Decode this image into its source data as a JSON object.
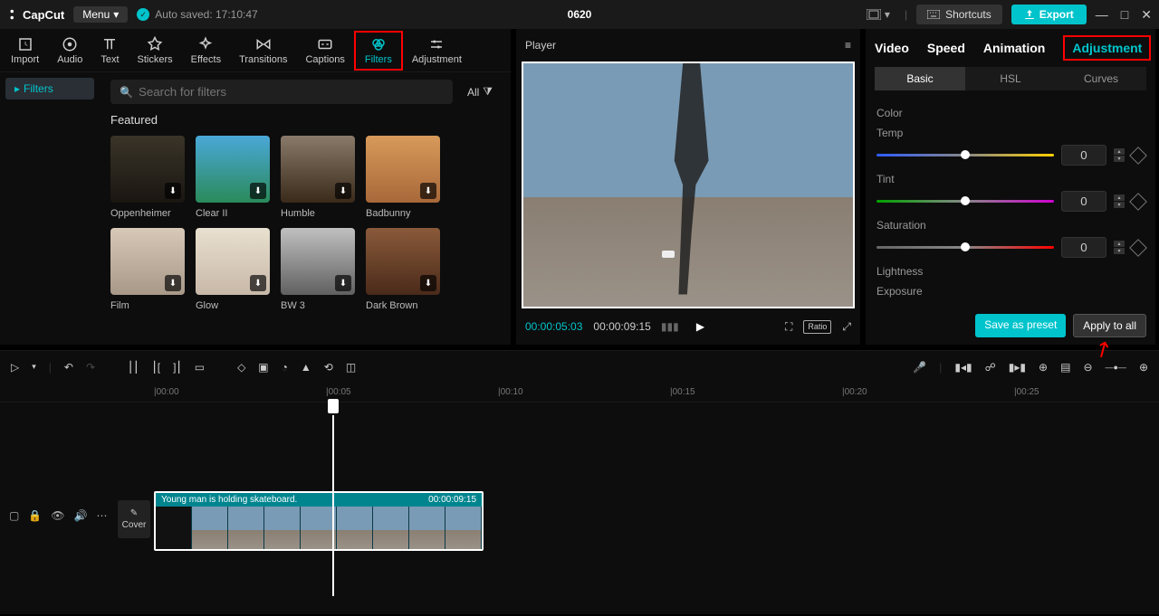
{
  "topbar": {
    "logo": "CapCut",
    "menu": "Menu",
    "autosave": "Auto saved: 17:10:47",
    "project": "0620",
    "shortcuts": "Shortcuts",
    "export": "Export"
  },
  "nav": {
    "import": "Import",
    "audio": "Audio",
    "text": "Text",
    "stickers": "Stickers",
    "effects": "Effects",
    "transitions": "Transitions",
    "captions": "Captions",
    "filters": "Filters",
    "adjustment": "Adjustment"
  },
  "sidebar": {
    "filters": "Filters"
  },
  "filters": {
    "search_placeholder": "Search for filters",
    "all": "All",
    "featured": "Featured",
    "items1": [
      "Oppenheimer",
      "Clear II",
      "Humble",
      "Badbunny"
    ],
    "items2": [
      "Film",
      "Glow",
      "BW 3",
      "Dark Brown"
    ]
  },
  "player": {
    "title": "Player",
    "current": "00:00:05:03",
    "duration": "00:00:09:15",
    "ratio": "Ratio"
  },
  "rp": {
    "tabs": {
      "video": "Video",
      "speed": "Speed",
      "animation": "Animation",
      "adjustment": "Adjustment"
    },
    "sub": {
      "basic": "Basic",
      "hsl": "HSL",
      "curves": "Curves"
    },
    "color_label": "Color",
    "temp": "Temp",
    "temp_v": "0",
    "tint": "Tint",
    "tint_v": "0",
    "sat": "Saturation",
    "sat_v": "0",
    "lightness": "Lightness",
    "exposure": "Exposure",
    "save_preset": "Save as preset",
    "apply_all": "Apply to all"
  },
  "timeline": {
    "marks": [
      "|00:00",
      "|00:05",
      "|00:10",
      "|00:15",
      "|00:20",
      "|00:25"
    ],
    "cover": "Cover",
    "clip_label": "Young man is holding skateboard.",
    "clip_time": "00:00:09:15"
  }
}
